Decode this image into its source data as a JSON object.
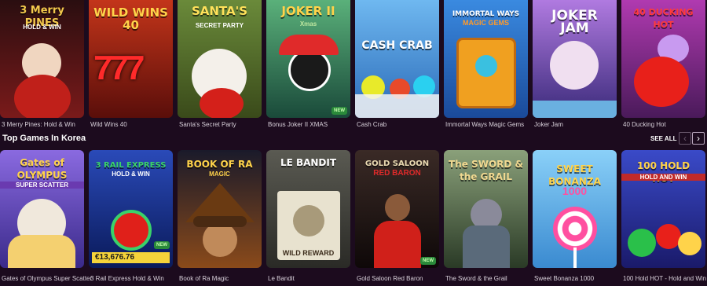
{
  "row1": [
    {
      "caption": "3 Merry Pines: Hold & Win",
      "title": "3 Merry PINES",
      "sub": "HOLD & WIN",
      "bg": "#7a1a1a",
      "accent": "#f2c94c"
    },
    {
      "caption": "Wild Wins 40",
      "title": "WILD WINS 40",
      "sub": "",
      "bg": "#8c1a12",
      "accent": "#ffd34a"
    },
    {
      "caption": "Santa's Secret Party",
      "title": "SANTA'S",
      "sub": "SECRET PARTY",
      "bg": "#4a6f2a",
      "accent": "#ffe15a"
    },
    {
      "caption": "Bonus Joker II XMAS",
      "title": "JOKER II",
      "sub": "Xmas",
      "bg": "#2f6a4a",
      "accent": "#ffd34a",
      "new": "NEW"
    },
    {
      "caption": "Cash Crab",
      "title": "CASH CRAB",
      "sub": "",
      "bg": "#3b7fd0",
      "accent": "#ffd34a"
    },
    {
      "caption": "Immortal Ways Magic Gems",
      "title": "IMMORTAL WAYS",
      "sub": "MAGIC GEMS",
      "bg": "#2d5fa0",
      "accent": "#ff9a2a"
    },
    {
      "caption": "Joker Jam",
      "title": "JOKER JAM",
      "sub": "",
      "bg": "#5a2e8a",
      "accent": "#f6c8ff"
    },
    {
      "caption": "40 Ducking Hot",
      "title": "40 DUCKING HOT",
      "sub": "",
      "bg": "#8e2a8e",
      "accent": "#ff3a3a"
    }
  ],
  "section": {
    "title": "Top Games In Korea",
    "see_all": "SEE ALL",
    "prev": "‹",
    "next": "›"
  },
  "row2": [
    {
      "caption": "Gates of Olympus Super Scatter",
      "title": "Gates of OLYMPUS",
      "sub": "SUPER SCATTER",
      "bg": "#5a3aa0",
      "accent": "#ffd34a"
    },
    {
      "caption": "3 Rail Express Hold & Win",
      "title": "3 RAIL EXPRESS",
      "sub": "HOLD & WIN",
      "bg": "#1a3a8a",
      "accent": "#3ad26a",
      "jackpot": "€13,676.76",
      "new": "NEW"
    },
    {
      "caption": "Book of Ra Magic",
      "title": "BOOK OF RA",
      "sub": "MAGIC",
      "bg": "#6a3a12",
      "accent": "#ffd34a"
    },
    {
      "caption": "Le Bandit",
      "title": "LE BANDIT",
      "sub": "WILD REWARD",
      "bg": "#3a3a3a",
      "accent": "#e8e2cf"
    },
    {
      "caption": "Gold Saloon Red Baron",
      "title": "GOLD SALOON",
      "sub": "RED BARON",
      "bg": "#2a1a16",
      "accent": "#e02a2a",
      "new": "NEW"
    },
    {
      "caption": "The Sword & the Grail",
      "title": "The SWORD & the GRAIL",
      "sub": "",
      "bg": "#4a5a3a",
      "accent": "#e0c070"
    },
    {
      "caption": "Sweet Bonanza 1000",
      "title": "SWEET BONANZA",
      "sub": "1000",
      "bg": "#5ab0e8",
      "accent": "#ff4fa0"
    },
    {
      "caption": "100 Hold HOT - Hold and Win",
      "title": "100 HOLD HOT",
      "sub": "HOLD AND WIN",
      "bg": "#2a3aa8",
      "accent": "#ffd34a"
    }
  ]
}
